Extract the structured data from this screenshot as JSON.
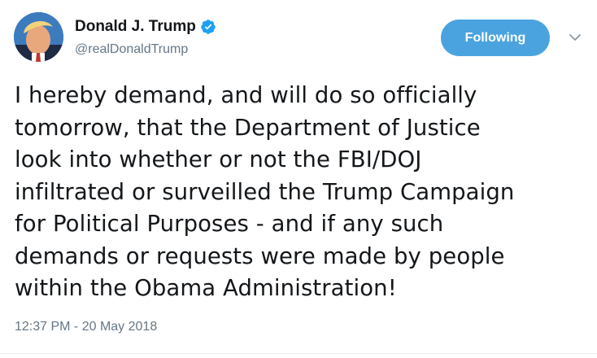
{
  "author": {
    "display_name": "Donald J. Trump",
    "handle": "@realDonaldTrump",
    "verified": true,
    "avatar_icon": "profile-photo"
  },
  "follow_button": {
    "label": "Following",
    "color": "#4aa3df"
  },
  "menu_icon": "chevron-down-icon",
  "tweet": {
    "lines": [
      "I hereby demand, and will do so officially",
      "tomorrow, that the Department of Justice",
      "look into whether or not the FBI/DOJ",
      "infiltrated or surveilled the Trump Campaign",
      "for Political Purposes - and if any such",
      "demands or requests were made by people",
      "within the Obama Administration!"
    ],
    "timestamp": "12:37 PM - 20 May 2018"
  },
  "colors": {
    "text": "#14171a",
    "secondary": "#657786",
    "verified_badge": "#1da1f2",
    "divider": "#e6ecf0"
  }
}
